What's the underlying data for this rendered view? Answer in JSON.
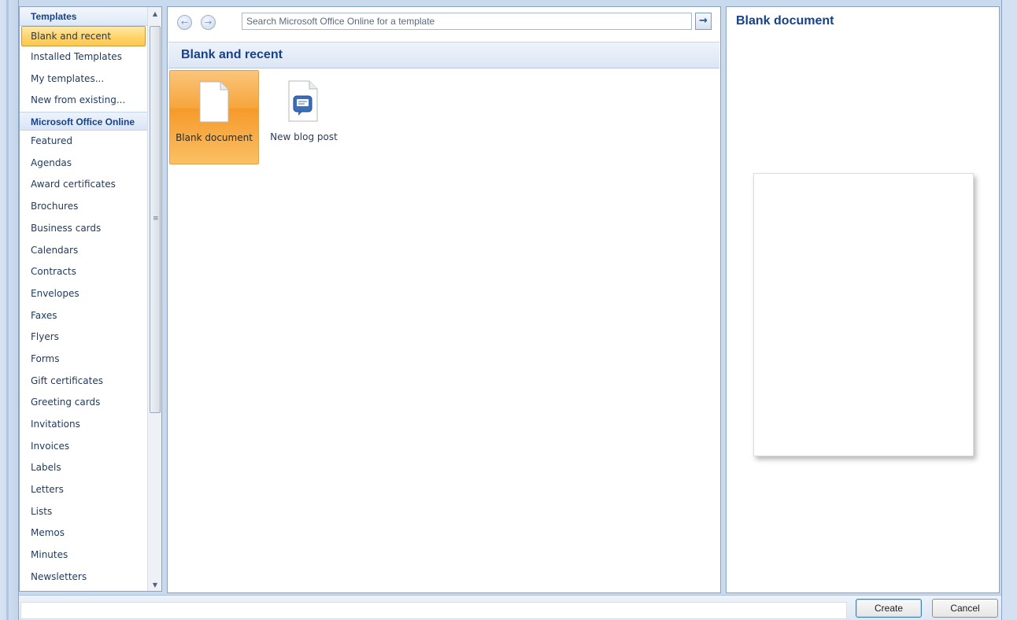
{
  "left_pane": {
    "header": "Templates",
    "items": [
      {
        "label": "Blank and recent",
        "selected": true
      },
      {
        "label": "Installed Templates"
      },
      {
        "label": "My templates..."
      },
      {
        "label": "New from existing..."
      }
    ],
    "section_label": "Microsoft Office Online",
    "online_items": [
      "Featured",
      "Agendas",
      "Award certificates",
      "Brochures",
      "Business cards",
      "Calendars",
      "Contracts",
      "Envelopes",
      "Faxes",
      "Flyers",
      "Forms",
      "Gift certificates",
      "Greeting cards",
      "Invitations",
      "Invoices",
      "Labels",
      "Letters",
      "Lists",
      "Memos",
      "Minutes",
      "Newsletters"
    ]
  },
  "toolbar": {
    "search_placeholder": "Search Microsoft Office Online for a template",
    "back_icon": "back-arrow-icon",
    "forward_icon": "forward-arrow-icon",
    "go_icon": "right-arrow-icon"
  },
  "main": {
    "section_title": "Blank and recent",
    "tiles": [
      {
        "label": "Blank document",
        "icon": "blank-document-icon",
        "selected": true
      },
      {
        "label": "New blog post",
        "icon": "blog-post-icon",
        "selected": false
      }
    ]
  },
  "preview": {
    "title": "Blank document"
  },
  "footer": {
    "create_label": "Create",
    "cancel_label": "Cancel"
  },
  "colors": {
    "selection_orange": "#f6a53c",
    "title_blue": "#15428b",
    "frame_blue": "#c9d9ee"
  }
}
